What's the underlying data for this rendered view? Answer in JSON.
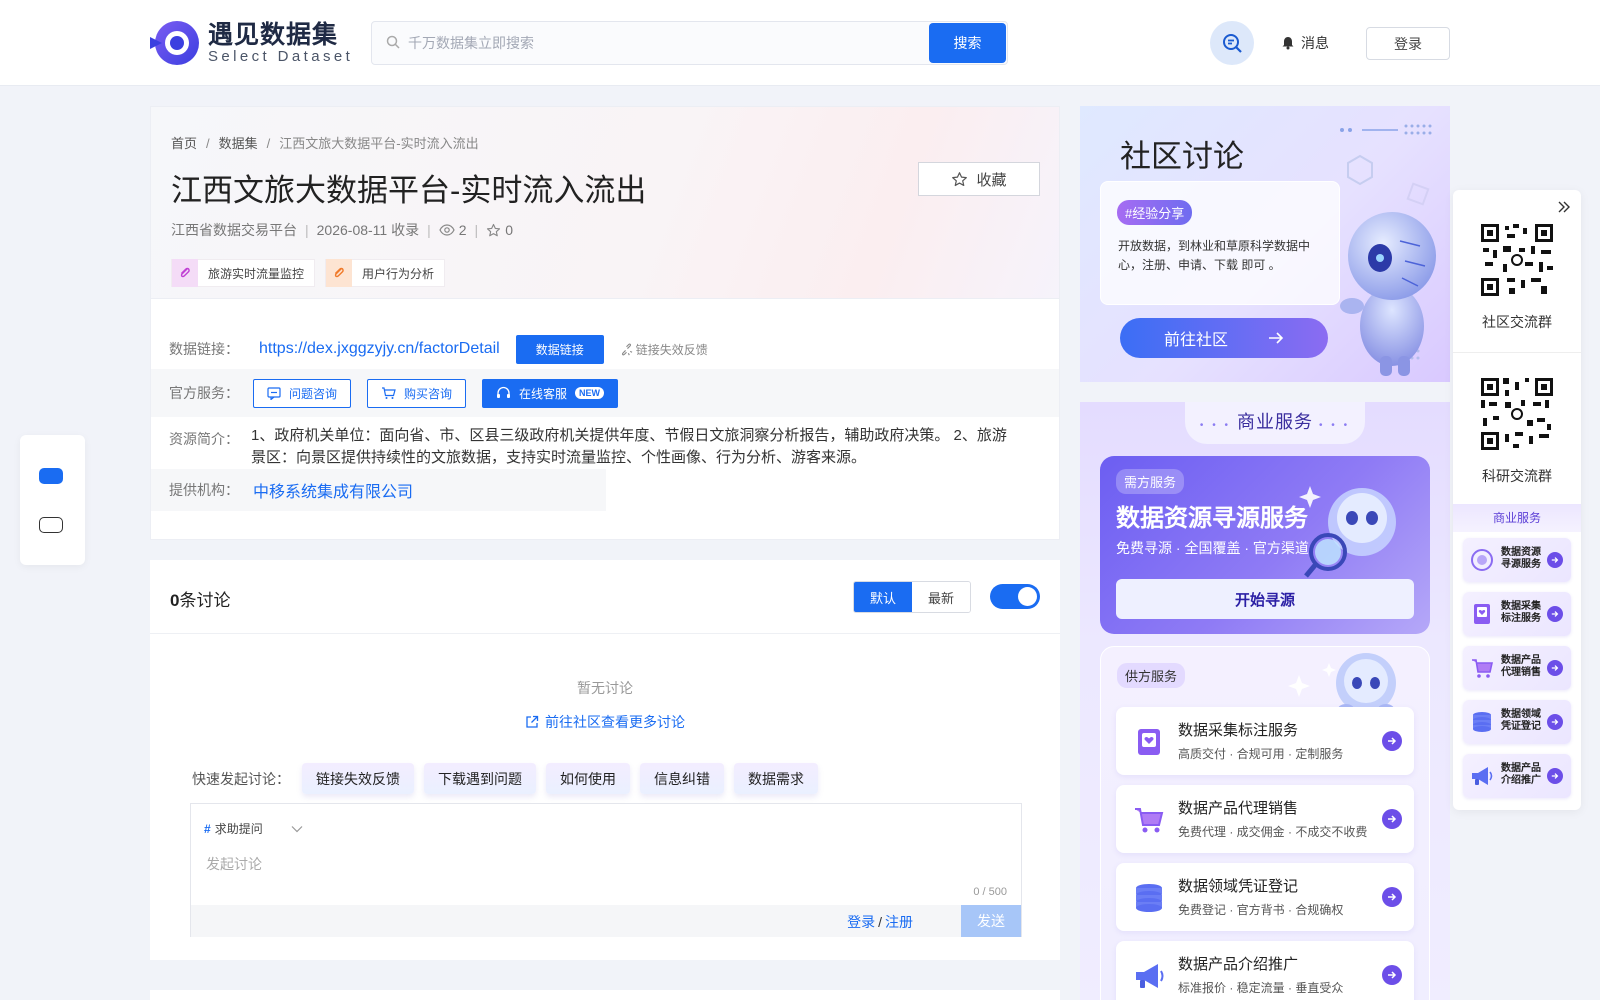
{
  "header": {
    "logo_cn": "遇见数据集",
    "logo_en": "Select Dataset",
    "search_placeholder": "千万数据集立即搜索",
    "search_button": "搜索",
    "messages_label": "消息",
    "login_label": "登录"
  },
  "breadcrumb": {
    "home": "首页",
    "sep": "/",
    "datasets": "数据集",
    "current": "江西文旅大数据平台-实时流入流出"
  },
  "dataset": {
    "title": "江西文旅大数据平台-实时流入流出",
    "favorite_label": "收藏",
    "source": "江西省数据交易平台",
    "date": "2026-08-11 收录",
    "views": "2",
    "stars": "0",
    "tags": [
      "旅游实时流量监控",
      "用户行为分析"
    ],
    "link_label": "数据链接：",
    "link_url": "https://dex.jxggzyjy.cn/factorDetail",
    "link_button": "数据链接",
    "link_feedback": "链接失效反馈",
    "service_label": "官方服务：",
    "services": [
      "问题咨询",
      "购买咨询",
      "在线客服"
    ],
    "new_badge": "NEW",
    "summary_label": "资源简介：",
    "summary": "1、政府机关单位：面向省、市、区县三级政府机关提供年度、节假日文旅洞察分析报告，辅助政府决策。 2、旅游景区：向景区提供持续性的文旅数据，支持实时流量监控、个性画像、行为分析、游客来源。",
    "provider_label": "提供机构：",
    "provider": "中移系统集成有限公司"
  },
  "discussion": {
    "count": "0",
    "count_suffix": "条讨论",
    "sort_default": "默认",
    "sort_latest": "最新",
    "empty_text": "暂无讨论",
    "more_link": "前往社区查看更多讨论",
    "quick_label": "快速发起讨论：",
    "quick_chips": [
      "链接失效反馈",
      "下载遇到问题",
      "如何使用",
      "信息纠错",
      "数据需求"
    ],
    "topic_hash": "#",
    "topic": "求助提问",
    "placeholder": "发起讨论",
    "counter": "0 / 500",
    "login": "登录",
    "slash": "/",
    "register": "注册",
    "send": "发送"
  },
  "community": {
    "title": "社区讨论",
    "tag": "#经验分享",
    "text": "开放数据，到林业和草原科学数据中心，注册、申请、下载 即可 。",
    "button": "前往社区"
  },
  "business": {
    "title": "商业服务",
    "demand_badge": "需方服务",
    "demand_title": "数据资源寻源服务",
    "demand_sub": "免费寻源 · 全国覆盖 · 官方渠道",
    "demand_button": "开始寻源",
    "supply_badge": "供方服务",
    "supply_items": [
      {
        "title": "数据采集标注服务",
        "sub": "高质交付 · 合规可用 · 定制服务"
      },
      {
        "title": "数据产品代理销售",
        "sub": "免费代理 · 成交佣金 · 不成交不收费"
      },
      {
        "title": "数据领域凭证登记",
        "sub": "免费登记 · 官方背书 · 合规确权"
      },
      {
        "title": "数据产品介绍推广",
        "sub": "标准报价 · 稳定流量 · 垂直受众"
      }
    ]
  },
  "qr_panel": {
    "community_group": "社区交流群",
    "research_group": "科研交流群",
    "business_title": "商业服务",
    "items": [
      "数据资源寻源服务",
      "数据采集标注服务",
      "数据产品代理销售",
      "数据领域凭证登记",
      "数据产品介绍推广"
    ]
  },
  "colors": {
    "primary": "#1a6cf2",
    "purple": "#6c4ee8"
  }
}
